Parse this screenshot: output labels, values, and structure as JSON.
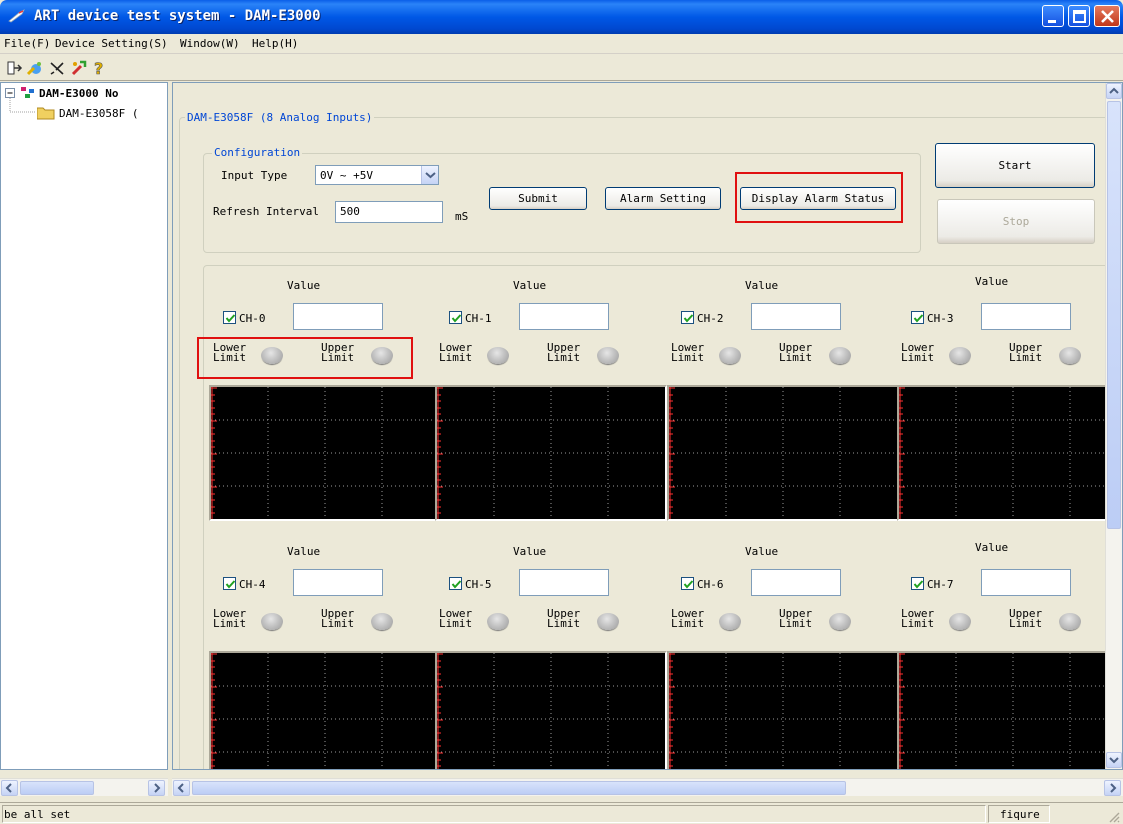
{
  "window": {
    "title": "ART device test system - DAM-E3000"
  },
  "menu": [
    "File(F)",
    "Device Setting(S)",
    "Window(W)",
    "Help(H)"
  ],
  "toolbar_icons": [
    "connect-icon",
    "device-scan-icon",
    "disconnect-icon",
    "settings-tool-icon",
    "help-icon"
  ],
  "tree": {
    "root": "DAM-E3000 No",
    "child": "DAM-E3058F ("
  },
  "panel": {
    "title": "DAM-E3058F (8 Analog Inputs)"
  },
  "config": {
    "title": "Configuration",
    "input_type_label": "Input Type",
    "input_type_value": "0V ~ +5V",
    "refresh_label": "Refresh Interval",
    "refresh_value": "500",
    "refresh_unit": "mS"
  },
  "buttons": {
    "submit": "Submit",
    "alarm_setting": "Alarm Setting",
    "display_alarm_status": "Display Alarm Status",
    "start": "Start",
    "stop": "Stop"
  },
  "channels": [
    {
      "label": "CH-0",
      "value_header": "Value",
      "value": "",
      "checked": true,
      "lower": "Lower\nLimit",
      "upper": "Upper\nLimit"
    },
    {
      "label": "CH-1",
      "value_header": "Value",
      "value": "",
      "checked": true,
      "lower": "Lower\nLimit",
      "upper": "Upper\nLimit"
    },
    {
      "label": "CH-2",
      "value_header": "Value",
      "value": "",
      "checked": true,
      "lower": "Lower\nLimit",
      "upper": "Upper\nLimit"
    },
    {
      "label": "CH-3",
      "value_header": "Value",
      "value": "",
      "checked": true,
      "lower": "Lower\nLimit",
      "upper": "Upper\nLimit"
    },
    {
      "label": "CH-4",
      "value_header": "Value",
      "value": "",
      "checked": true,
      "lower": "Lower\nLimit",
      "upper": "Upper\nLimit"
    },
    {
      "label": "CH-5",
      "value_header": "Value",
      "value": "",
      "checked": true,
      "lower": "Lower\nLimit",
      "upper": "Upper\nLimit"
    },
    {
      "label": "CH-6",
      "value_header": "Value",
      "value": "",
      "checked": true,
      "lower": "Lower\nLimit",
      "upper": "Upper\nLimit"
    },
    {
      "label": "CH-7",
      "value_header": "Value",
      "value": "",
      "checked": true,
      "lower": "Lower\nLimit",
      "upper": "Upper\nLimit"
    }
  ],
  "status": {
    "left": "be all set",
    "right": "fiqure"
  },
  "colors": {
    "title_bar": "#0058e6",
    "highlight": "#e01010",
    "group_title": "#0046d5",
    "scope_bg": "#000000",
    "scope_tick": "#ff3030"
  }
}
